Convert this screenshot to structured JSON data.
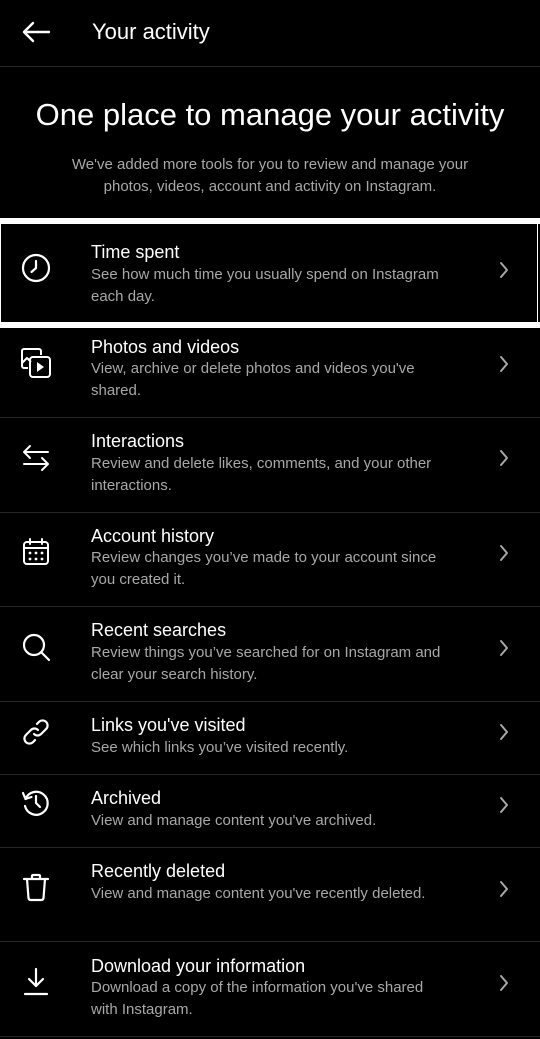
{
  "header": {
    "title": "Your activity"
  },
  "intro": {
    "heading": "One place to manage your activity",
    "description": "We've added more tools for you to review and manage your photos, videos, account and activity on Instagram."
  },
  "items": [
    {
      "icon": "clock-icon",
      "title": "Time spent",
      "subtitle": "See how much time you usually spend on Instagram each day."
    },
    {
      "icon": "photos-videos-icon",
      "title": "Photos and videos",
      "subtitle": "View, archive or delete photos and videos you've shared."
    },
    {
      "icon": "interactions-icon",
      "title": "Interactions",
      "subtitle": "Review and delete likes, comments, and your other interactions."
    },
    {
      "icon": "calendar-icon",
      "title": "Account history",
      "subtitle": "Review changes you’ve made to your account since you created it."
    },
    {
      "icon": "search-icon",
      "title": "Recent searches",
      "subtitle": "Review things you’ve searched for on Instagram and clear your search history."
    },
    {
      "icon": "link-icon",
      "title": "Links you've visited",
      "subtitle": "See which links you’ve visited recently."
    },
    {
      "icon": "archive-icon",
      "title": "Archived",
      "subtitle": "View and manage content you've archived."
    },
    {
      "icon": "trash-icon",
      "title": "Recently deleted",
      "subtitle": "View and manage content you've recently deleted."
    },
    {
      "icon": "download-icon",
      "title": "Download your information",
      "subtitle": "Download a copy of the information you've shared with Instagram."
    }
  ],
  "colors": {
    "background": "#000000",
    "primary_text": "#ffffff",
    "secondary_text": "#a8a8a8",
    "divider": "#262626",
    "highlight": "#ffffff"
  }
}
